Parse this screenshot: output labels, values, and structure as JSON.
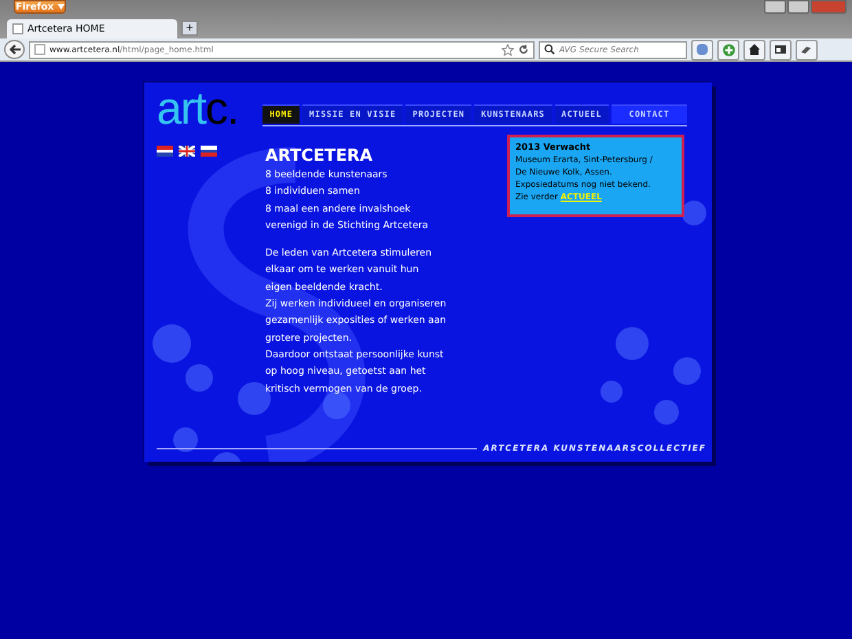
{
  "browser": {
    "menu_button": "Firefox",
    "tab_title": "Artcetera HOME",
    "new_tab": "+",
    "url_host": "www.artcetera.nl",
    "url_path": "/html/page_home.html",
    "search_placeholder": "AVG Secure Search"
  },
  "logo": {
    "main": "art",
    "accent": "c."
  },
  "nav": [
    {
      "label": "HOME",
      "selected": true
    },
    {
      "label": "MISSIE EN VISIE",
      "selected": false
    },
    {
      "label": "PROJECTEN",
      "selected": false
    },
    {
      "label": "KUNSTENAARS",
      "selected": false
    },
    {
      "label": "ACTUEEL",
      "selected": false
    },
    {
      "label": "CONTACT",
      "selected": false
    }
  ],
  "languages": [
    {
      "kind": "nl"
    },
    {
      "kind": "uk"
    },
    {
      "kind": "ru"
    }
  ],
  "heading": "ARTCETERA",
  "intro_lines": [
    "8 beeldende kunstenaars",
    "8 individuen samen",
    "8 maal een andere invalshoek",
    "verenigd in de Stichting Artcetera"
  ],
  "body_lines": [
    "De leden van Artcetera stimuleren",
    "elkaar om te werken vanuit hun",
    "eigen beeldende kracht.",
    "Zij werken individueel en organiseren",
    "gezamenlijk exposities of werken aan",
    "grotere projecten.",
    "Daardoor ontstaat persoonlijke kunst",
    "op hoog niveau, getoetst aan het",
    "kritisch vermogen van de groep."
  ],
  "news": {
    "title": "2013 Verwacht",
    "lines": [
      "Museum Erarta, Sint-Petersburg /",
      "De Nieuwe Kolk, Assen.",
      "Exposiedatums nog niet bekend."
    ],
    "more_text": "Zie verder",
    "more_link": "ACTUEEL"
  },
  "footer": "ARTCETERA KUNSTENAARSCOLLECTIEF"
}
